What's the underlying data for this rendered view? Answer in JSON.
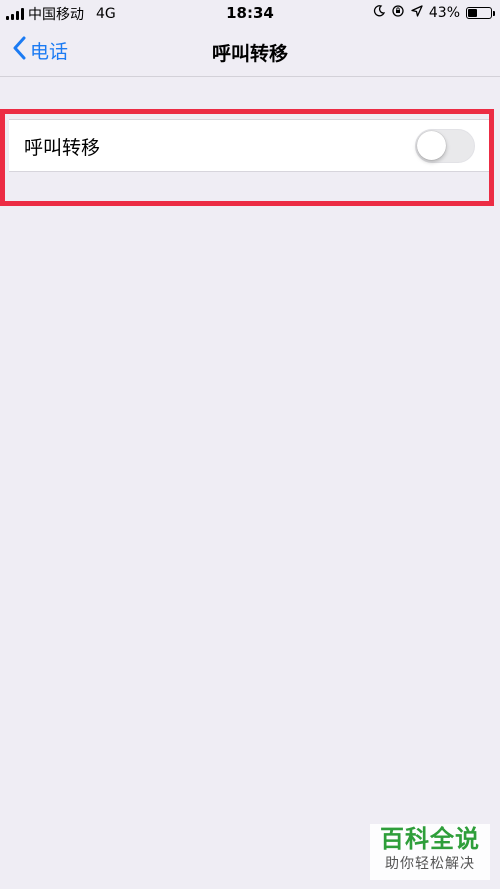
{
  "status_bar": {
    "carrier": "中国移动",
    "network": "4G",
    "time": "18:34",
    "battery_percent": "43%",
    "battery_level": 0.43,
    "icons": [
      "signal-icon",
      "moon-icon",
      "rotation-lock-icon",
      "location-icon",
      "battery-icon"
    ]
  },
  "nav": {
    "back_label": "电话",
    "title": "呼叫转移",
    "accent_color": "#1b7bf3"
  },
  "settings": {
    "call_forwarding_label": "呼叫转移",
    "call_forwarding_enabled": false
  },
  "highlight": {
    "color": "#ec2c44"
  },
  "watermark": {
    "title": "百科全说",
    "subtitle": "助你轻松解决",
    "color": "#2e9e3a"
  }
}
